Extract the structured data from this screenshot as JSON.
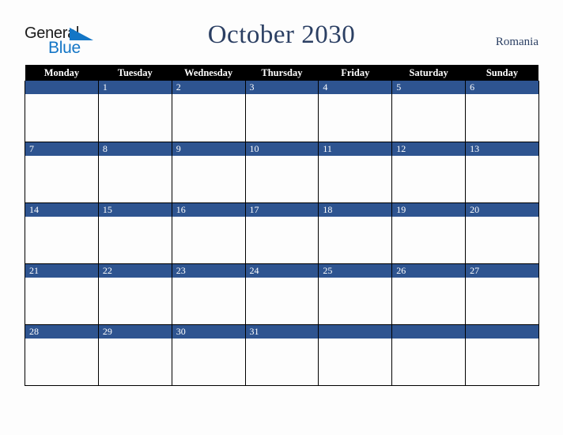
{
  "brand": {
    "name_part1": "General",
    "name_part2": "Blue",
    "triangle_icon": "triangle-icon",
    "colors": {
      "blue": "#1476c6",
      "black": "#1a1a1a"
    }
  },
  "header": {
    "title": "October 2030",
    "country": "Romania",
    "title_color": "#2b3f63"
  },
  "calendar": {
    "month": "October",
    "year": "2030",
    "accent_color": "#2e5490",
    "header_bg": "#000000",
    "weekdays": [
      "Monday",
      "Tuesday",
      "Wednesday",
      "Thursday",
      "Friday",
      "Saturday",
      "Sunday"
    ],
    "weeks": [
      [
        {
          "day": ""
        },
        {
          "day": "1"
        },
        {
          "day": "2"
        },
        {
          "day": "3"
        },
        {
          "day": "4"
        },
        {
          "day": "5"
        },
        {
          "day": "6"
        }
      ],
      [
        {
          "day": "7"
        },
        {
          "day": "8"
        },
        {
          "day": "9"
        },
        {
          "day": "10"
        },
        {
          "day": "11"
        },
        {
          "day": "12"
        },
        {
          "day": "13"
        }
      ],
      [
        {
          "day": "14"
        },
        {
          "day": "15"
        },
        {
          "day": "16"
        },
        {
          "day": "17"
        },
        {
          "day": "18"
        },
        {
          "day": "19"
        },
        {
          "day": "20"
        }
      ],
      [
        {
          "day": "21"
        },
        {
          "day": "22"
        },
        {
          "day": "23"
        },
        {
          "day": "24"
        },
        {
          "day": "25"
        },
        {
          "day": "26"
        },
        {
          "day": "27"
        }
      ],
      [
        {
          "day": "28"
        },
        {
          "day": "29"
        },
        {
          "day": "30"
        },
        {
          "day": "31"
        },
        {
          "day": ""
        },
        {
          "day": ""
        },
        {
          "day": ""
        }
      ]
    ]
  }
}
